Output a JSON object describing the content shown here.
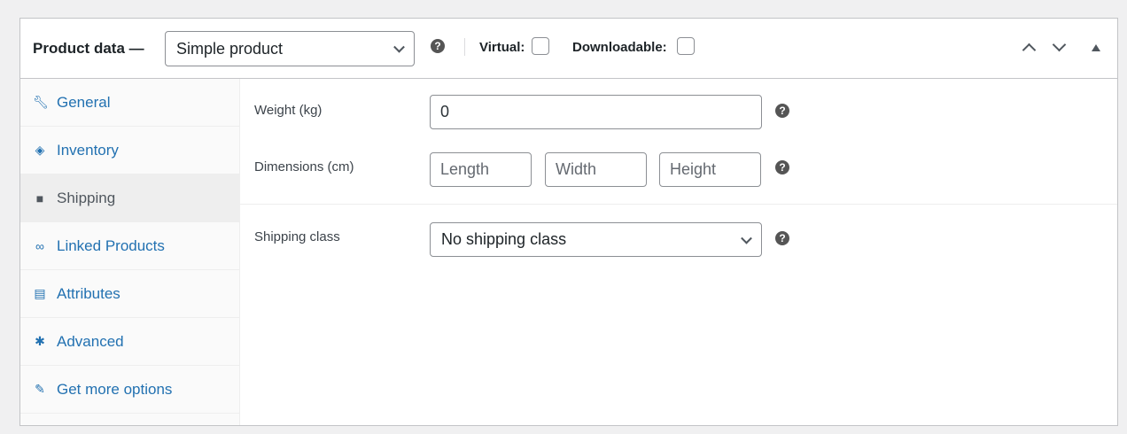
{
  "header": {
    "title": "Product data —",
    "product_type": "Simple product",
    "virtual_label": "Virtual:",
    "downloadable_label": "Downloadable:",
    "help": "?"
  },
  "tabs": [
    {
      "label": "General",
      "icon": "wrench-icon"
    },
    {
      "label": "Inventory",
      "icon": "tag-icon"
    },
    {
      "label": "Shipping",
      "icon": "truck-icon"
    },
    {
      "label": "Linked Products",
      "icon": "link-icon"
    },
    {
      "label": "Attributes",
      "icon": "list-icon"
    },
    {
      "label": "Advanced",
      "icon": "gear-icon"
    },
    {
      "label": "Get more options",
      "icon": "plugin-icon"
    }
  ],
  "shipping": {
    "weight_label": "Weight (kg)",
    "weight_value": "0",
    "dimensions_label": "Dimensions (cm)",
    "length_placeholder": "Length",
    "width_placeholder": "Width",
    "height_placeholder": "Height",
    "class_label": "Shipping class",
    "class_value": "No shipping class"
  }
}
